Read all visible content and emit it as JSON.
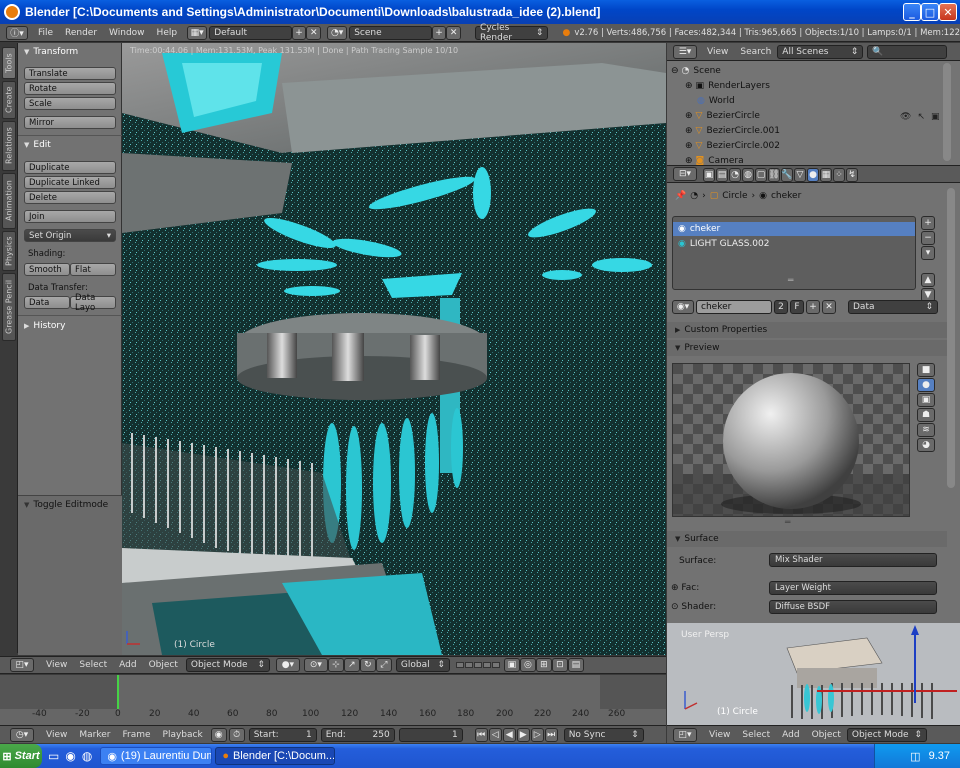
{
  "window": {
    "title": "Blender [C:\\Documents and Settings\\Administrator\\Documenti\\Downloads\\balustrada_idee (2).blend]",
    "min": "_",
    "max": "□",
    "close": "✕"
  },
  "topbar": {
    "menus": [
      "File",
      "Render",
      "Window",
      "Help"
    ],
    "layout": "Default",
    "scene": "Scene",
    "engine": "Cycles Render",
    "stats": "v2.76 | Verts:486,756 | Faces:482,344 | Tris:965,665 | Objects:1/10 | Lamps:0/1 | Mem:122"
  },
  "tool_tabs": [
    "Tools",
    "Create",
    "Relations",
    "Animation",
    "Physics",
    "Grease Pencil"
  ],
  "tools": {
    "transform_header": "Transform",
    "translate": "Translate",
    "rotate": "Rotate",
    "scale": "Scale",
    "mirror": "Mirror",
    "edit_header": "Edit",
    "duplicate": "Duplicate",
    "duplicate_linked": "Duplicate Linked",
    "delete": "Delete",
    "join": "Join",
    "set_origin": "Set Origin",
    "shading_label": "Shading:",
    "smooth": "Smooth",
    "flat": "Flat",
    "data_transfer_label": "Data Transfer:",
    "data": "Data",
    "data_layo": "Data Layo",
    "history_header": "History",
    "toggle_editmode": "Toggle Editmode"
  },
  "viewport": {
    "stats": "Time:00:44.06 | Mem:131.53M, Peak 131.53M | Done | Path Tracing Sample 10/10",
    "object_label": "(1) Circle"
  },
  "vp_header": {
    "view": "View",
    "select": "Select",
    "add": "Add",
    "object": "Object",
    "mode": "Object Mode",
    "orientation": "Global"
  },
  "timeline": {
    "ticks": [
      "-40",
      "-20",
      "0",
      "20",
      "40",
      "60",
      "80",
      "100",
      "120",
      "140",
      "160",
      "180",
      "200",
      "220",
      "240",
      "260"
    ],
    "current_frame": 1,
    "view": "View",
    "marker": "Marker",
    "frame": "Frame",
    "playback": "Playback",
    "start_label": "Start:",
    "start": "1",
    "end_label": "End:",
    "end": "250",
    "frame_value": "1",
    "sync": "No Sync"
  },
  "outliner": {
    "view": "View",
    "search": "Search",
    "filter": "All Scenes",
    "items": [
      "Scene",
      "RenderLayers",
      "World",
      "BezierCircle",
      "BezierCircle.001",
      "BezierCircle.002",
      "Camera"
    ]
  },
  "properties": {
    "breadcrumb_object": "Circle",
    "breadcrumb_material": "cheker",
    "slots": [
      "cheker",
      "LIGHT GLASS.002"
    ],
    "material_name": "cheker",
    "users": "2",
    "fake": "F",
    "link": "Data",
    "custom_props": "Custom Properties",
    "preview": "Preview",
    "surface_header": "Surface",
    "surface_label": "Surface:",
    "surface_value": "Mix Shader",
    "fac_label": "Fac:",
    "fac_value": "Layer Weight",
    "shader_label": "Shader:",
    "shader_value": "Diffuse BSDF"
  },
  "mini_viewport": {
    "label": "User Persp",
    "object_label": "(1) Circle"
  },
  "mini_header": {
    "view": "View",
    "select": "Select",
    "add": "Add",
    "object": "Object",
    "mode": "Object Mode"
  },
  "taskbar": {
    "start": "Start",
    "task1": "(19) Laurentiu Dum...",
    "task2": "Blender [C:\\Docum...",
    "clock": "9.37"
  },
  "colors": {
    "accent": "#5680c2",
    "cyan": "#28d0e0",
    "title": "#0a5fe0"
  }
}
